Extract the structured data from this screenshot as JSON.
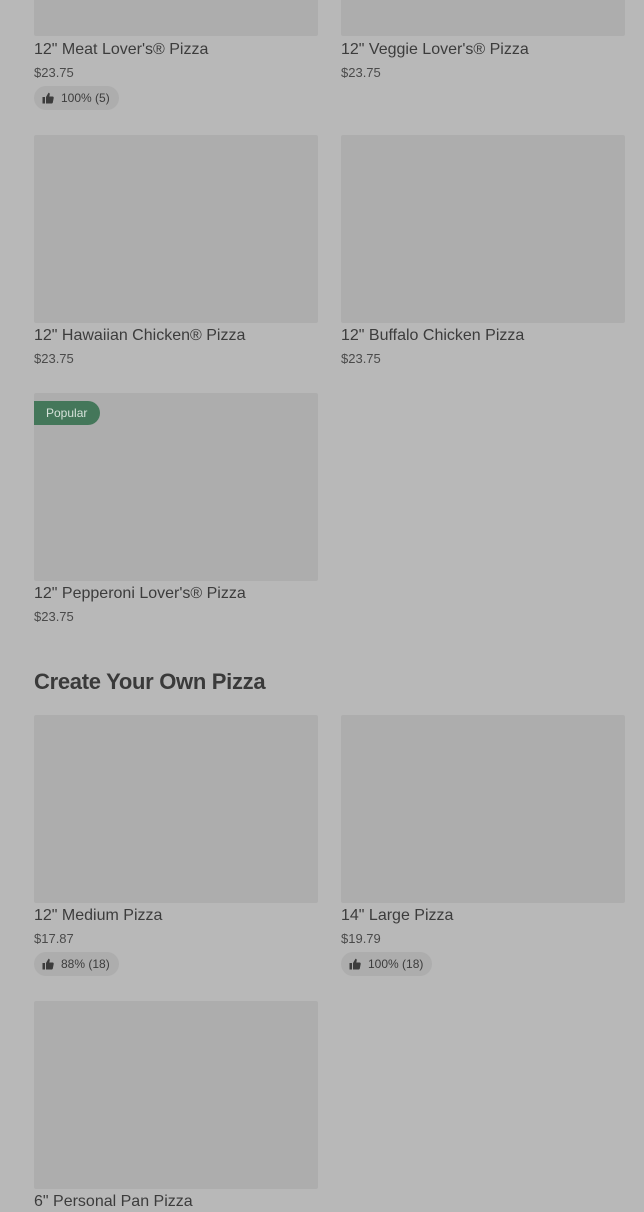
{
  "colors": {
    "page_background": "#b8b8b8",
    "image_placeholder": "#adadad",
    "popular_badge": "#44775a"
  },
  "specialty_pizzas": [
    {
      "name": "12\" Meat Lover's® Pizza",
      "price": "$23.75",
      "rating": "100% (5)"
    },
    {
      "name": "12\" Veggie Lover's® Pizza",
      "price": "$23.75"
    },
    {
      "name": "12\" Hawaiian Chicken® Pizza",
      "price": "$23.75"
    },
    {
      "name": "12\" Buffalo Chicken Pizza",
      "price": "$23.75"
    },
    {
      "name": "12\" Pepperoni Lover's® Pizza",
      "price": "$23.75",
      "badge": "Popular"
    }
  ],
  "create_your_own": {
    "title": "Create Your Own Pizza",
    "items": [
      {
        "name": "12\" Medium Pizza",
        "price": "$17.87",
        "rating": "88% (18)"
      },
      {
        "name": "14\" Large Pizza",
        "price": "$19.79",
        "rating": "100% (18)"
      },
      {
        "name": "6\" Personal Pan Pizza"
      }
    ]
  }
}
